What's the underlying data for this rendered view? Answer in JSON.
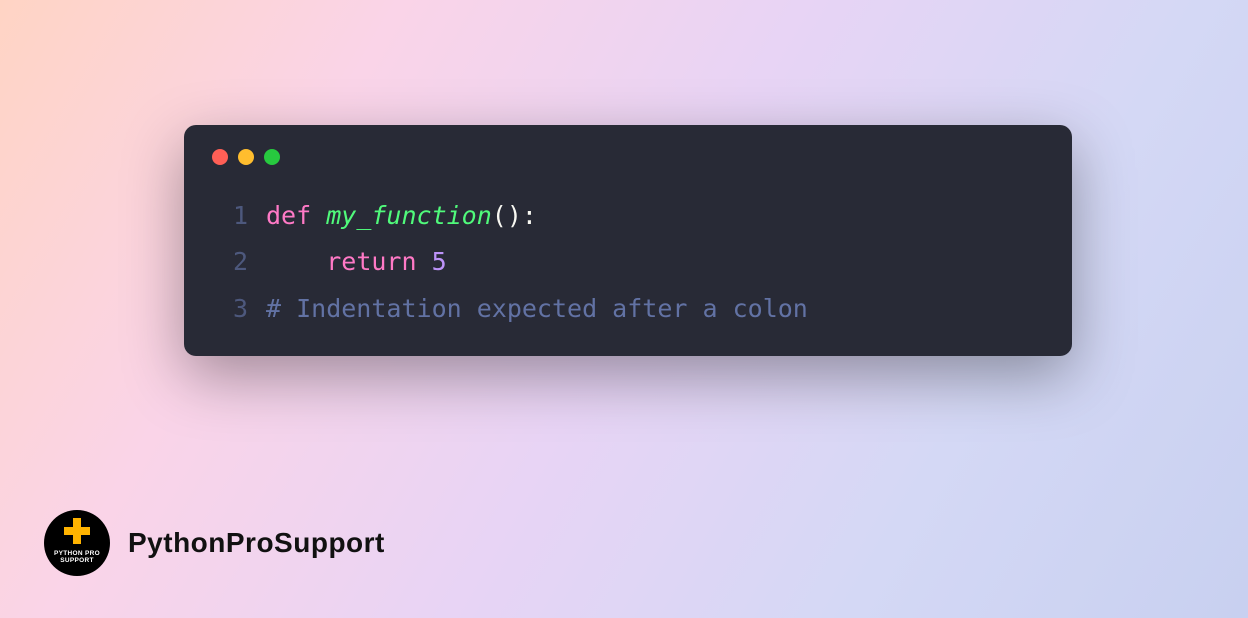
{
  "code": {
    "lines": [
      {
        "num": "1",
        "tokens": [
          {
            "t": "def ",
            "cls": "tok-keyword"
          },
          {
            "t": "my_function",
            "cls": "tok-funcname"
          },
          {
            "t": "():",
            "cls": "tok-punct"
          }
        ]
      },
      {
        "num": "2",
        "tokens": [
          {
            "t": "    ",
            "cls": "tok-punct"
          },
          {
            "t": "return ",
            "cls": "tok-keyword"
          },
          {
            "t": "5",
            "cls": "tok-number"
          }
        ]
      },
      {
        "num": "3",
        "tokens": [
          {
            "t": "# Indentation expected after a colon",
            "cls": "tok-comment"
          }
        ]
      }
    ]
  },
  "attribution": {
    "name": "PythonProSupport",
    "avatar_text_top": "PYTHON PRO",
    "avatar_text_bottom": "SUPPORT"
  }
}
